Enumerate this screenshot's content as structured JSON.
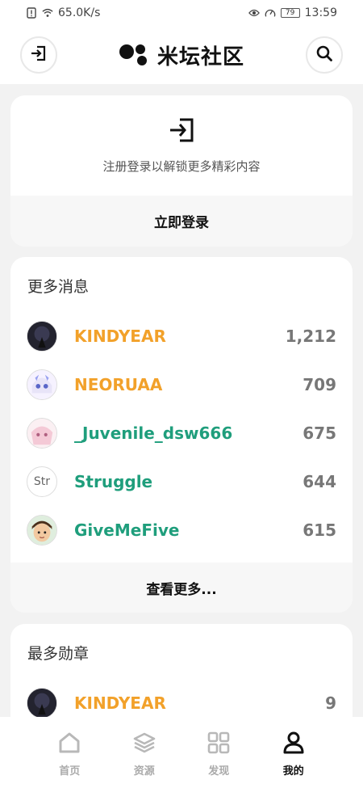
{
  "status_bar": {
    "network_speed": "65.0K/s",
    "battery": "79",
    "time": "13:59"
  },
  "header": {
    "app_name": "米坛社区"
  },
  "login_card": {
    "hint": "注册登录以解锁更多精彩内容",
    "button_label": "立即登录"
  },
  "news_section": {
    "title": "更多消息",
    "users": [
      {
        "name": "KINDYEAR",
        "count": "1,212",
        "name_color": "#f2a12a",
        "avatar": "dark-night-avatar"
      },
      {
        "name": "NEORUAA",
        "count": "709",
        "name_color": "#f2a12a",
        "avatar": "anime-girl-avatar"
      },
      {
        "name": "_Juvenile_dsw666",
        "count": "675",
        "name_color": "#1f9e7c",
        "avatar": "anime-pink-avatar"
      },
      {
        "name": "Struggle",
        "count": "644",
        "name_color": "#1f9e7c",
        "avatar": "text-avatar",
        "avatar_text": "Str"
      },
      {
        "name": "GiveMeFive",
        "count": "615",
        "name_color": "#1f9e7c",
        "avatar": "cartoon-face-avatar"
      }
    ],
    "more_label": "查看更多..."
  },
  "medal_section": {
    "title": "最多勋章",
    "users": [
      {
        "name": "KINDYEAR",
        "count": "9",
        "name_color": "#f2a12a",
        "avatar": "dark-night-avatar"
      }
    ]
  },
  "bottom_nav": {
    "items": [
      {
        "label": "首页",
        "icon": "home-icon",
        "active": false
      },
      {
        "label": "资源",
        "icon": "layers-icon",
        "active": false
      },
      {
        "label": "发现",
        "icon": "grid-icon",
        "active": false
      },
      {
        "label": "我的",
        "icon": "user-icon",
        "active": true
      }
    ]
  }
}
